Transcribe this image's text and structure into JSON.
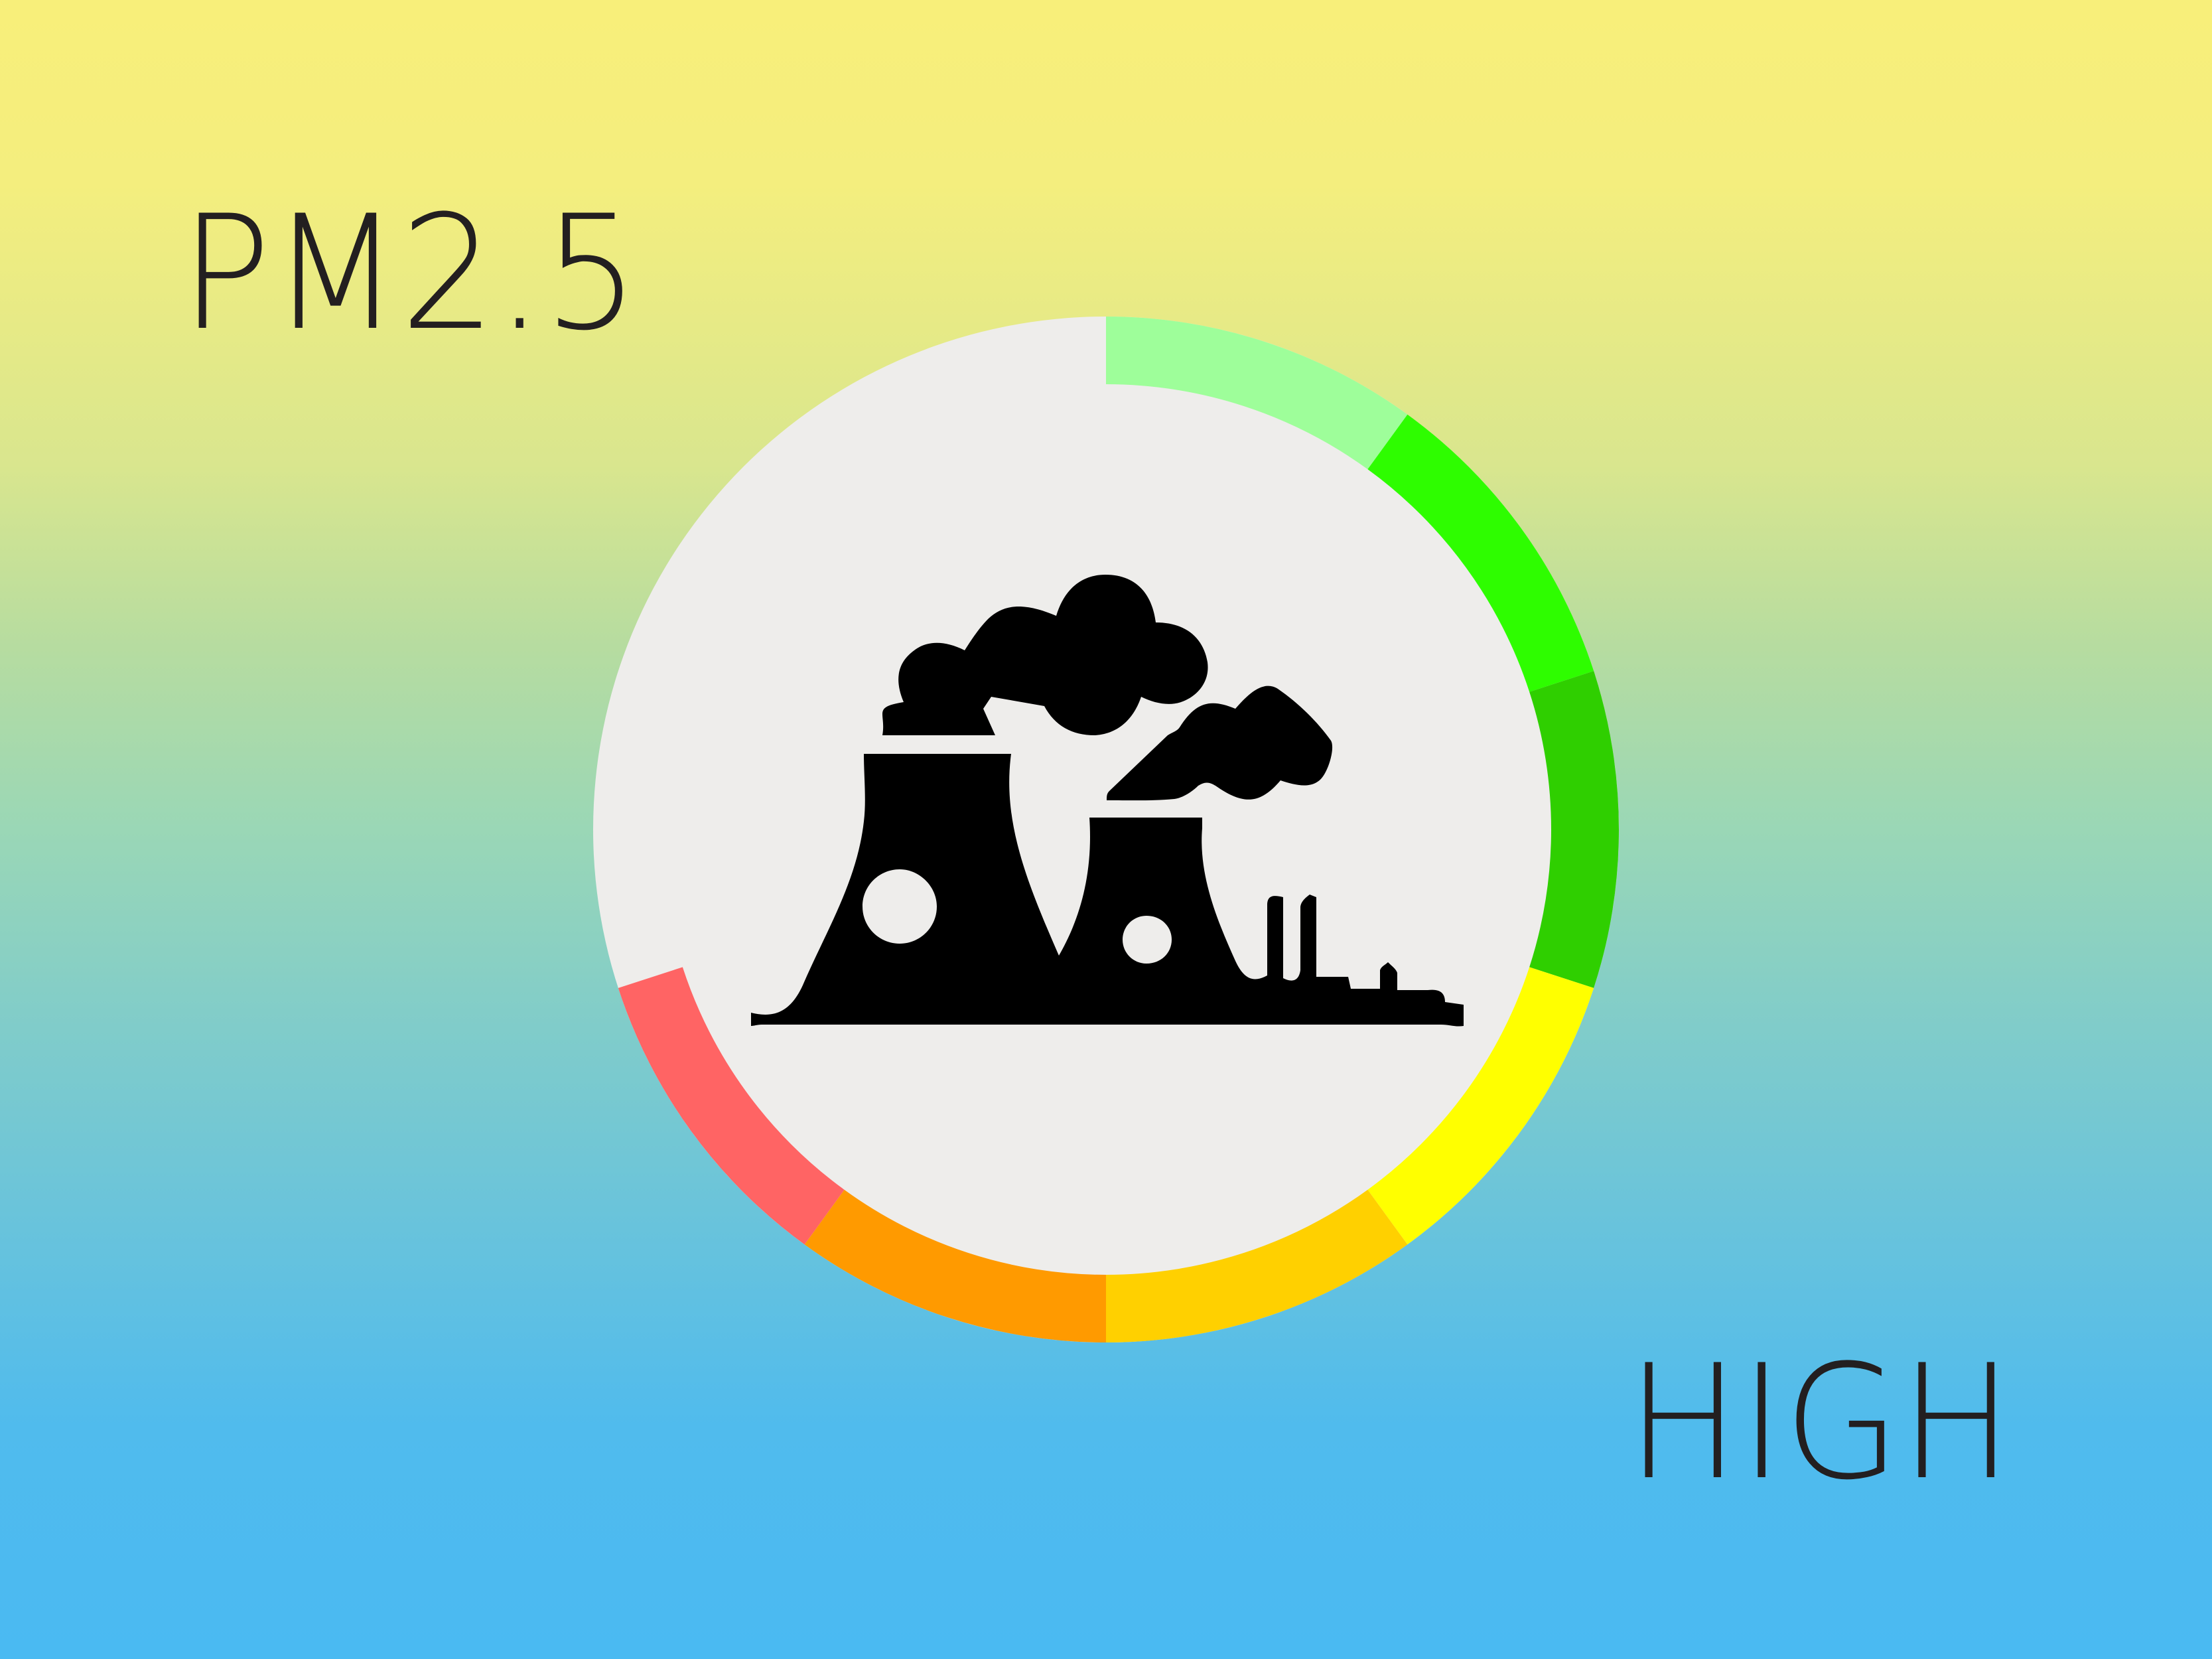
{
  "metric_label": "PM2.5",
  "level_label": "HIGH",
  "gauge": {
    "background_color": "#eeedeb",
    "start_angle_deg": -90,
    "gap_color": "#eeedeb",
    "segments": [
      {
        "from_deg": 0,
        "to_deg": 36,
        "color": "#9efe9a"
      },
      {
        "from_deg": 36,
        "to_deg": 72,
        "color": "#2efd00"
      },
      {
        "from_deg": 72,
        "to_deg": 108,
        "color": "#2fcf00"
      },
      {
        "from_deg": 108,
        "to_deg": 144,
        "color": "#ffff00"
      },
      {
        "from_deg": 144,
        "to_deg": 180,
        "color": "#ffd000"
      },
      {
        "from_deg": 180,
        "to_deg": 216,
        "color": "#ff9a00"
      },
      {
        "from_deg": 216,
        "to_deg": 252,
        "color": "#ff6464"
      }
    ]
  },
  "icon": {
    "name": "factory-pollution-icon",
    "color": "#000000"
  },
  "text_color": "#231f20"
}
